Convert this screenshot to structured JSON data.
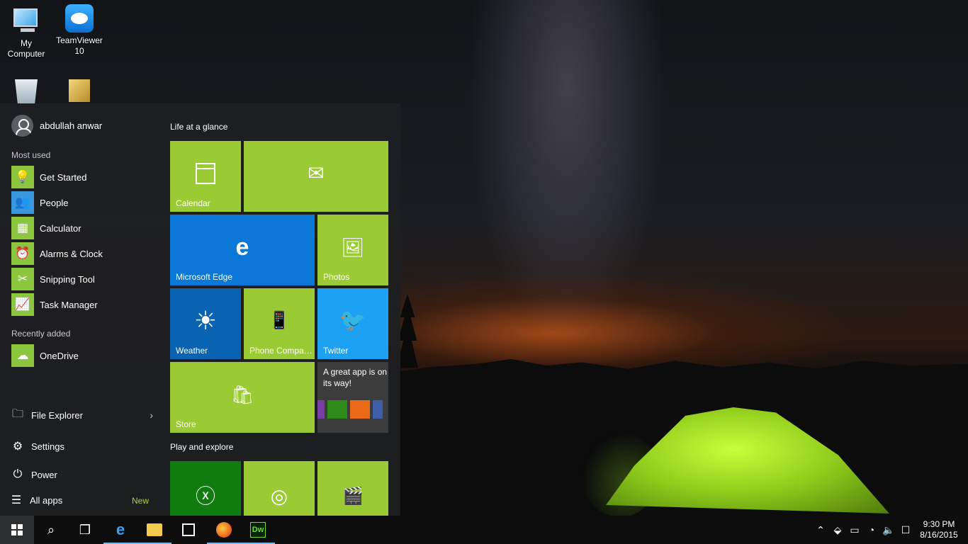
{
  "desktop": {
    "icons": [
      {
        "label": "My\nComputer"
      },
      {
        "label": "TeamViewer\n10"
      }
    ]
  },
  "start_menu": {
    "user": {
      "name": "abdullah anwar"
    },
    "most_used_label": "Most used",
    "most_used": [
      {
        "label": "Get Started",
        "icon": "lightbulb-icon"
      },
      {
        "label": "People",
        "icon": "people-icon"
      },
      {
        "label": "Calculator",
        "icon": "calculator-icon"
      },
      {
        "label": "Alarms & Clock",
        "icon": "alarm-clock-icon"
      },
      {
        "label": "Snipping Tool",
        "icon": "scissors-icon"
      },
      {
        "label": "Task Manager",
        "icon": "task-manager-icon"
      }
    ],
    "recently_added_label": "Recently added",
    "recently_added": [
      {
        "label": "OneDrive",
        "icon": "onedrive-icon"
      }
    ],
    "bottom": {
      "file_explorer": "File Explorer",
      "settings": "Settings",
      "power": "Power",
      "all_apps": "All apps",
      "new_badge": "New"
    },
    "groups": {
      "life": "Life at a glance",
      "play": "Play and explore"
    },
    "tiles": {
      "calendar": "Calendar",
      "mail": "",
      "edge": "Microsoft Edge",
      "photos": "Photos",
      "weather": "Weather",
      "phone": "Phone Compa…",
      "twitter": "Twitter",
      "store": "Store",
      "promo": "A great app is on its way!"
    }
  },
  "taskbar": {
    "time": "9:30 PM",
    "date": "8/16/2015",
    "dw_label": "Dw"
  },
  "colors": {
    "tile_lime": "#9bcb34",
    "edge_blue": "#0b78d7",
    "weather_blue": "#0a62b3",
    "twitter_blue": "#1da1f2",
    "xbox_green": "#107c10"
  }
}
